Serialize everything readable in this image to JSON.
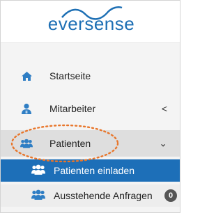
{
  "brand": {
    "logo_text": "eversense",
    "logo_color": "#1d6fb4"
  },
  "sidebar": {
    "items": [
      {
        "label": "Startseite",
        "icon": "home-icon"
      },
      {
        "label": "Mitarbeiter",
        "icon": "user-doctor-icon",
        "chevron": "<"
      },
      {
        "label": "Patienten",
        "icon": "users-icon",
        "chevron": "⌄",
        "highlighted": true
      }
    ],
    "subitems": [
      {
        "label": "Patienten einladen",
        "icon": "users-icon",
        "active": true
      },
      {
        "label": "Ausstehende Anfragen",
        "icon": "users-icon",
        "badge": "0"
      }
    ]
  },
  "colors": {
    "accent": "#1d6fb8",
    "icon_blue": "#2f7ec4",
    "highlight_ring": "#e8762b",
    "menu_background": "#f4f4f4"
  }
}
